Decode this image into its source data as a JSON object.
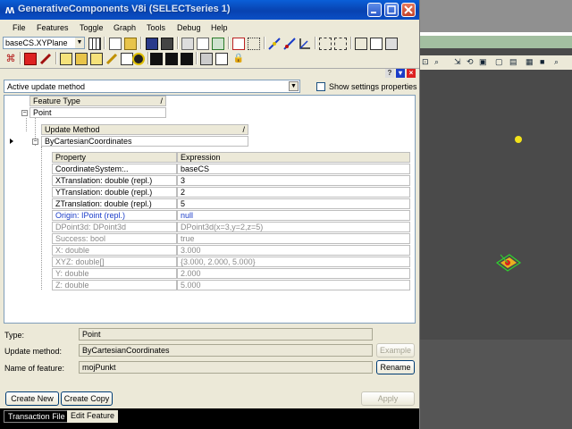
{
  "window": {
    "title": "GenerativeComponents V8i (SELECTseries 1)",
    "app_icon": "gc-logo-icon"
  },
  "menu": [
    "File",
    "Features",
    "Toggle",
    "Graph",
    "Tools",
    "Debug",
    "Help"
  ],
  "toolbar": {
    "plane_select": "baseCS.XYPlane"
  },
  "panel": {
    "method_select": "Active update method",
    "show_settings_label": "Show settings properties",
    "show_settings_checked": false
  },
  "tree": {
    "feature_type_header": "Feature Type",
    "feature_type": "Point",
    "update_method_header": "Update Method",
    "update_method": "ByCartesianCoordinates",
    "columns": [
      "Property",
      "Expression"
    ],
    "rows": [
      {
        "property": "CoordinateSystem:..",
        "expression": "baseCS",
        "style": "normal"
      },
      {
        "property": "XTranslation: double (repl.)",
        "expression": "3",
        "style": "normal"
      },
      {
        "property": "YTranslation: double (repl.)",
        "expression": "2",
        "style": "normal"
      },
      {
        "property": "ZTranslation: double (repl.)",
        "expression": "5",
        "style": "normal"
      },
      {
        "property": "Origin: IPoint (repl.)",
        "expression": "null",
        "style": "blue"
      },
      {
        "property": "DPoint3d: DPoint3d",
        "expression": "DPoint3d(x=3,y=2,z=5)",
        "style": "grey"
      },
      {
        "property": "Success: bool",
        "expression": "true",
        "style": "grey"
      },
      {
        "property": "X: double",
        "expression": "3.000",
        "style": "grey"
      },
      {
        "property": "XYZ: double[]",
        "expression": "{3.000, 2.000, 5.000}",
        "style": "grey"
      },
      {
        "property": "Y: double",
        "expression": "2.000",
        "style": "grey"
      },
      {
        "property": "Z: double",
        "expression": "5.000",
        "style": "grey"
      }
    ]
  },
  "footer": {
    "type_label": "Type:",
    "type_value": "Point",
    "method_label": "Update method:",
    "method_value": "ByCartesianCoordinates",
    "example_button": "Example",
    "name_label": "Name of feature:",
    "name_value": "mojPunkt",
    "rename_button": "Rename",
    "create_new_button": "Create New",
    "create_copy_button": "Create Copy",
    "apply_button": "Apply"
  },
  "tabs": [
    "Transaction File",
    "Edit Feature"
  ],
  "colors": {
    "titlebar": "#0842b0",
    "point_marker": "#f2e21a",
    "selected_point": "#d82020",
    "viewport_bg": "#4a4a4a"
  }
}
